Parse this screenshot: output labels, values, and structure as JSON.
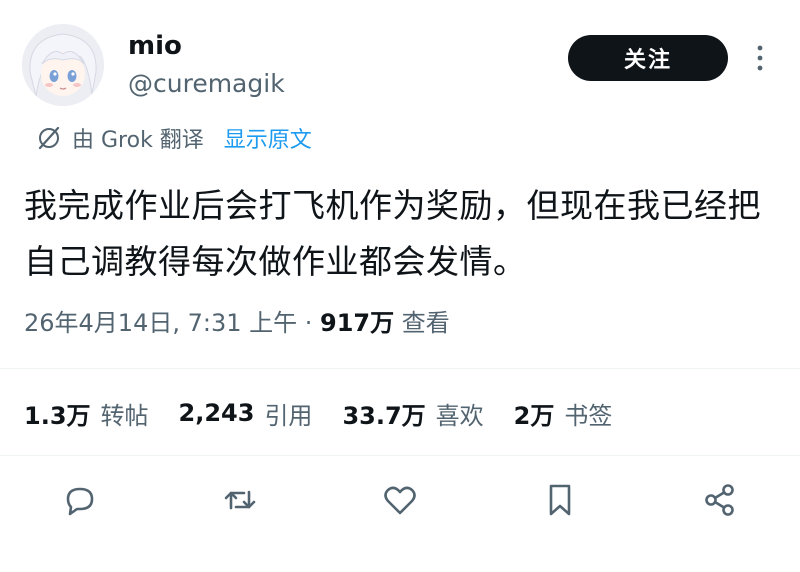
{
  "author": {
    "name": "mio",
    "handle": "@curemagik"
  },
  "follow_button": {
    "label": "关注"
  },
  "translation": {
    "provider_text": "由 Grok 翻译",
    "show_original_label": "显示原文"
  },
  "tweet": {
    "text": "我完成作业后会打飞机作为奖励，但现在我已经把自己调教得每次做作业都会发情。"
  },
  "meta": {
    "timestamp": "26年4月14日, 7:31 上午 · ",
    "views_count": "917万",
    "views_label": " 查看"
  },
  "stats": [
    {
      "count": "1.3万",
      "label": "转帖"
    },
    {
      "count": "2,243",
      "label": "引用"
    },
    {
      "count": "33.7万",
      "label": "喜欢"
    },
    {
      "count": "2万",
      "label": "书签"
    }
  ],
  "actions": [
    "reply-icon",
    "repost-icon",
    "like-icon",
    "bookmark-icon",
    "share-icon"
  ],
  "colors": {
    "text": "#0f1419",
    "secondary": "#536471",
    "link": "#1d9bf0",
    "button_bg": "#0f1419",
    "icon": "#536471"
  }
}
